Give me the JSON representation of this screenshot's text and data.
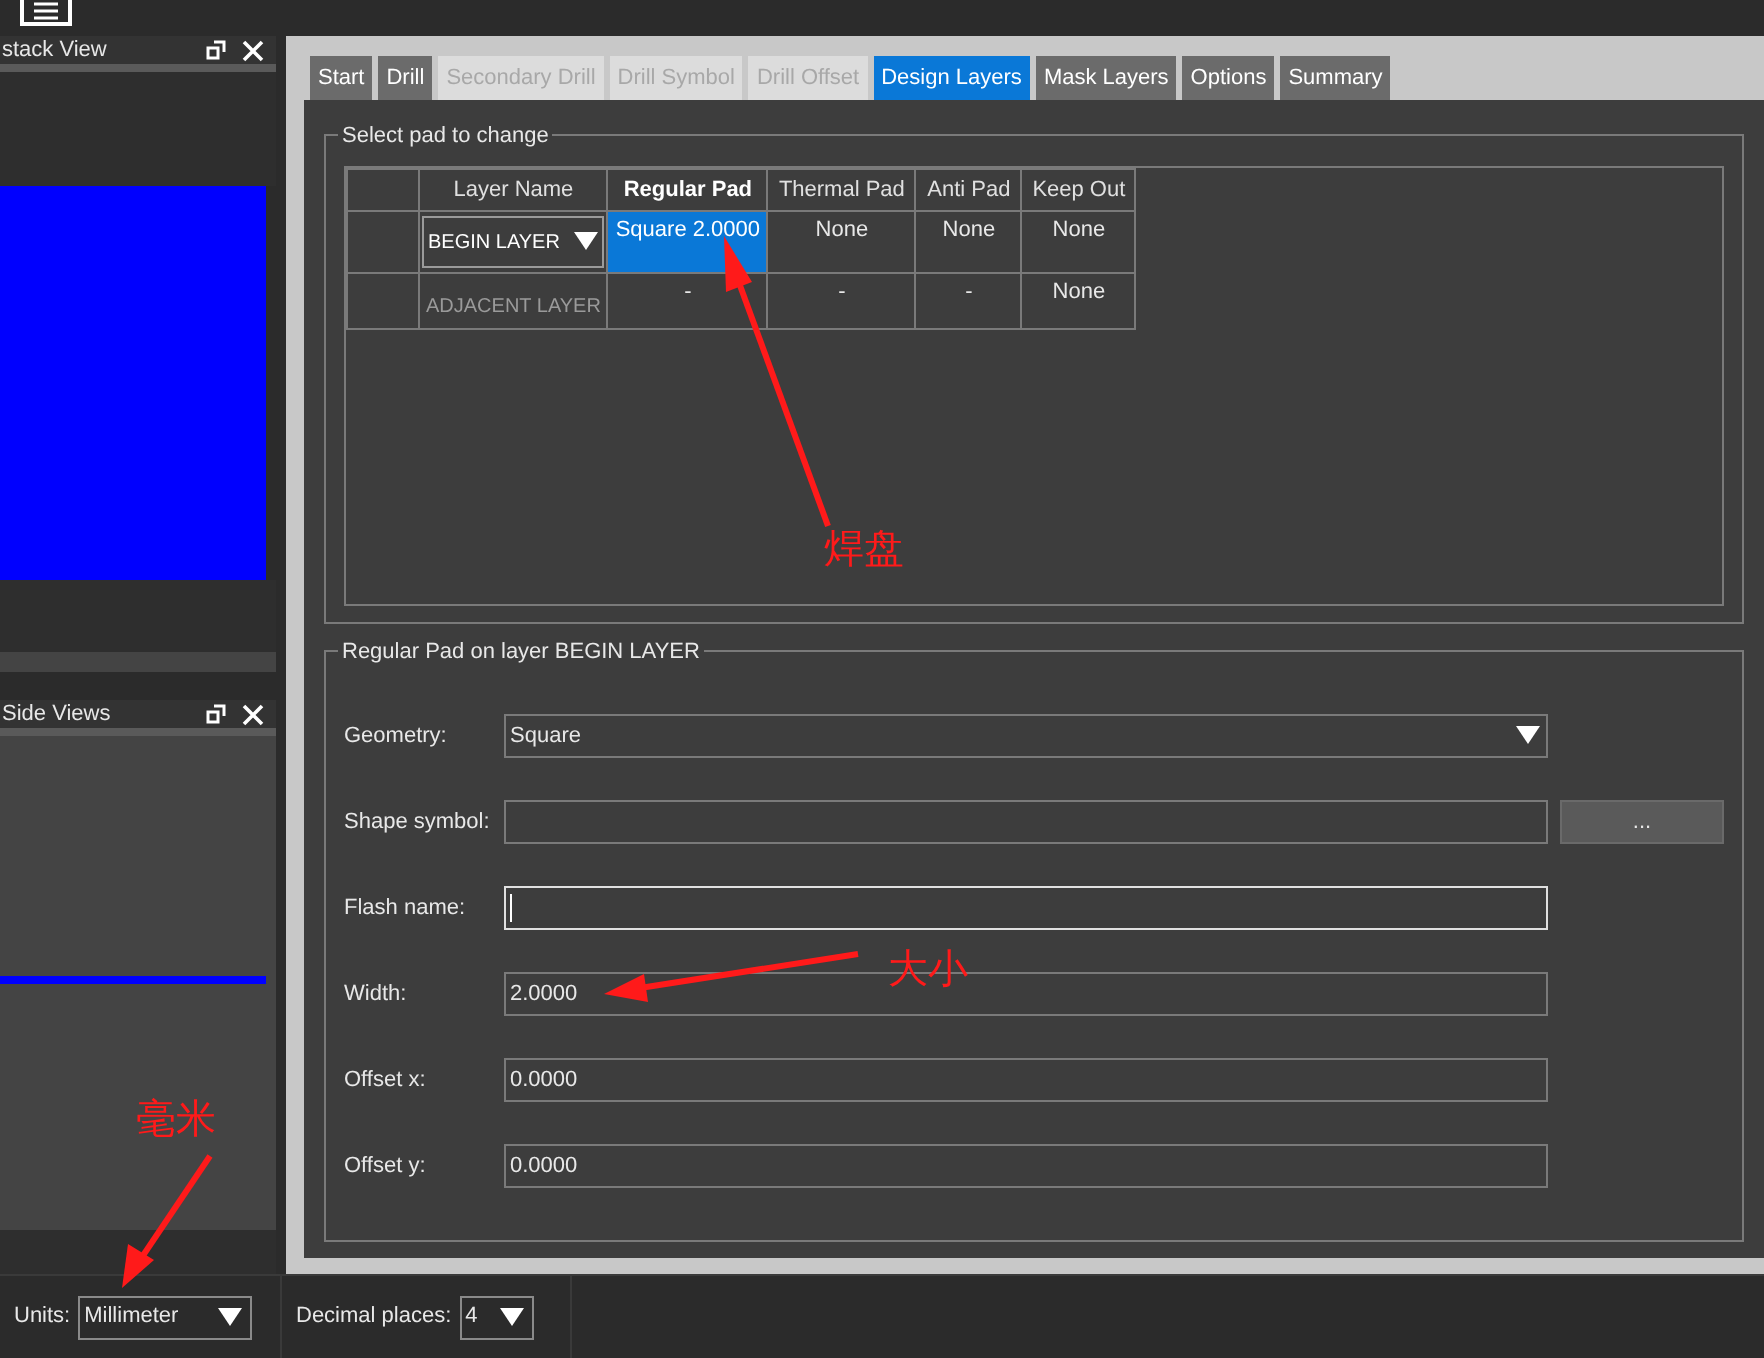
{
  "panels": [
    {
      "title": "stack View"
    },
    {
      "title": "Side Views"
    }
  ],
  "tabs": [
    {
      "label": "Start",
      "selected": false,
      "disabled": false
    },
    {
      "label": "Drill",
      "selected": false,
      "disabled": false
    },
    {
      "label": "Secondary Drill",
      "selected": false,
      "disabled": true
    },
    {
      "label": "Drill Symbol",
      "selected": false,
      "disabled": true
    },
    {
      "label": "Drill Offset",
      "selected": false,
      "disabled": true
    },
    {
      "label": "Design Layers",
      "selected": true,
      "disabled": false
    },
    {
      "label": "Mask Layers",
      "selected": false,
      "disabled": false
    },
    {
      "label": "Options",
      "selected": false,
      "disabled": false
    },
    {
      "label": "Summary",
      "selected": false,
      "disabled": false
    }
  ],
  "pad_table": {
    "title": "Select pad to change",
    "columns": [
      {
        "label": "Layer Name",
        "selected": false
      },
      {
        "label": "Regular Pad",
        "selected": true
      },
      {
        "label": "Thermal Pad",
        "selected": false
      },
      {
        "label": "Anti Pad",
        "selected": false
      },
      {
        "label": "Keep Out",
        "selected": false
      }
    ],
    "rows": [
      {
        "cells": [
          {
            "kind": "dropdown",
            "text": "BEGIN LAYER",
            "selected": false
          },
          {
            "kind": "value",
            "text": "Square 2.0000",
            "selected": true
          },
          {
            "kind": "value",
            "text": "None",
            "selected": false
          },
          {
            "kind": "value",
            "text": "None",
            "selected": false
          },
          {
            "kind": "value",
            "text": "None",
            "selected": false
          }
        ]
      },
      {
        "cells": [
          {
            "kind": "label",
            "text": "ADJACENT LAYER",
            "selected": false
          },
          {
            "kind": "value",
            "text": "-",
            "selected": false
          },
          {
            "kind": "value",
            "text": "-",
            "selected": false
          },
          {
            "kind": "value",
            "text": "-",
            "selected": false
          },
          {
            "kind": "value",
            "text": "None",
            "selected": false
          }
        ]
      }
    ]
  },
  "pad_form": {
    "title": "Regular Pad on layer BEGIN LAYER",
    "fields": [
      {
        "kind": "dropdown",
        "label": "Geometry:",
        "value": "Square",
        "focused": false
      },
      {
        "kind": "browse",
        "label": "Shape symbol:",
        "button": "...",
        "focused": false
      },
      {
        "kind": "text",
        "label": "Flash name:",
        "focused": true
      },
      {
        "kind": "text",
        "label": "Width:",
        "value": "2.0000",
        "focused": false
      },
      {
        "kind": "text",
        "label": "Offset x:",
        "value": "0.0000",
        "focused": false
      },
      {
        "kind": "text",
        "label": "Offset y:",
        "value": "0.0000",
        "focused": false
      }
    ]
  },
  "status_bar": {
    "units": {
      "label": "Units:",
      "value": "Millimeter"
    },
    "decimal_places": {
      "label": "Decimal places:",
      "value": "4"
    }
  },
  "annotations": [
    {
      "text": "焊盘"
    },
    {
      "text": "大小"
    },
    {
      "text": "毫米"
    }
  ]
}
